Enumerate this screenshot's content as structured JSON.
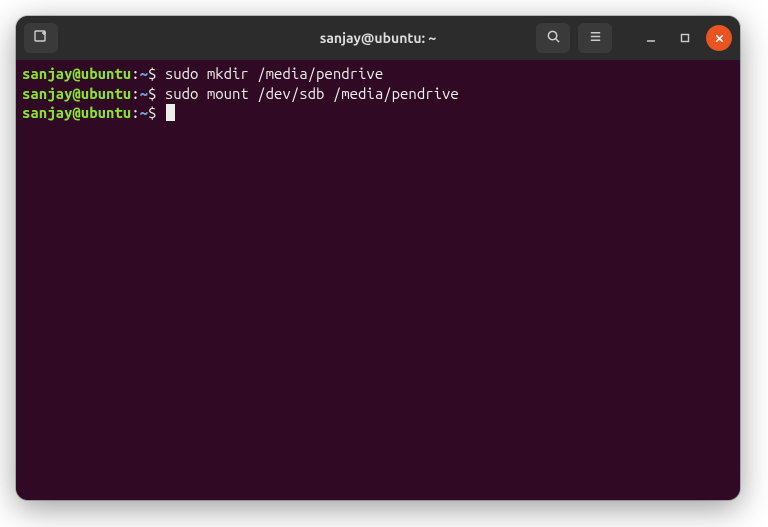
{
  "window": {
    "title": "sanjay@ubuntu: ~"
  },
  "prompt": {
    "user_host": "sanjay@ubuntu",
    "separator": ":",
    "path": "~",
    "symbol": "$"
  },
  "lines": [
    {
      "command": "sudo mkdir /media/pendrive"
    },
    {
      "command": "sudo mount /dev/sdb /media/pendrive"
    },
    {
      "command": ""
    }
  ],
  "icons": {
    "new_tab": "new-tab",
    "search": "search",
    "menu": "menu",
    "minimize": "minimize",
    "maximize": "maximize",
    "close": "close"
  }
}
